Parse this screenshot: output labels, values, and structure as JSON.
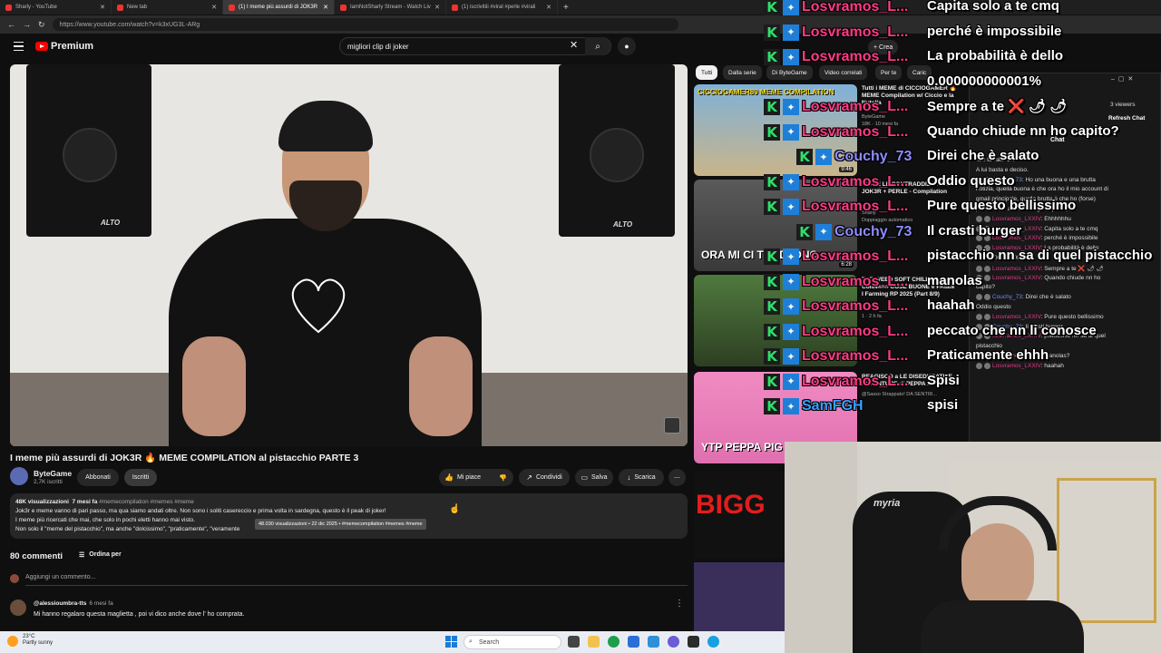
{
  "browser": {
    "tabs": [
      {
        "title": "Sharly - YouTube",
        "active": false
      },
      {
        "title": "New tab",
        "active": false
      },
      {
        "title": "(1) I meme più assurdi di JOK3R",
        "active": true
      },
      {
        "title": "IamNotSharly Stream - Watch Liv",
        "active": false
      },
      {
        "title": "(1) iscrivitiii #viral #perle #virali",
        "active": false
      }
    ],
    "url": "https://www.youtube.com/watch?v=k3xUG3L-ARg"
  },
  "youtube": {
    "logo": "Premium",
    "search_value": "migliori clip di joker",
    "create_label": "Crea",
    "video": {
      "title": "I meme più assurdi di JOK3R 🔥 MEME COMPILATION al pistacchio PARTE 3",
      "channel": "ByteGame",
      "subscribers": "2,7K iscritti",
      "subscriptions_label": "Abbonati",
      "subscribed_label": "Iscritti",
      "like_label": "Mi piace",
      "share_label": "Condividi",
      "save_label": "Salva",
      "download_label": "Scarica",
      "speaker_brand": "ALTO"
    },
    "description": {
      "views": "48K visualizzazioni",
      "date": "7 mesi fa",
      "tags": "#memecompilation #memes #meme",
      "line1": "Jok3r e meme vanno di pari passo, ma qua siamo andati oltre. Non sono i soliti casereccio e prima volta in sardegna, questo è il peak di joker!",
      "line2": "I meme più ricercati che mai, che solo in pochi eletti hanno mai visto.",
      "line3": "Non solo il \"meme del pistacchio\", ma anche \"dolcissimo\", \"praticamente\", \"veramente",
      "tooltip": "48.030 visualizzazioni • 22 dic 2025 • #memecompilation #memes #meme"
    },
    "comments": {
      "count": "80 commenti",
      "sort_label": "Ordina per",
      "add_placeholder": "Aggiungi un commento...",
      "items": [
        {
          "user": "@alessioumbra-tts",
          "time": "6 mesi fa",
          "text": "Mi hanno regalaro questa maglietta , poi vi dico anche dove l' ho comprata."
        }
      ]
    },
    "chips": [
      "Tutti",
      "Dalla serie",
      "Di ByteGame",
      "Video correlati",
      "Per te",
      "Caric"
    ],
    "recommendations": [
      {
        "title": "Tutti i MEME di CICCIOGAMER 🔥 MEME Compilation w/ Ciccio e la Nutella",
        "channel": "ByteGame",
        "meta": "18K · 10 mesi fa",
        "duration": "9:46",
        "thumb_text": "CICCIOGAMER89 MEME COMPILATION"
      },
      {
        "title": "TUTTE LE CONTRADDIZIONI di JOK3R + PERLE - Compilation",
        "channel": "Sharly",
        "meta": "Doppiaggio automatico",
        "duration": "6:28",
        "thumb_text": "ORA MI CI TRADI ONO"
      },
      {
        "title": "THE WEED SOFT CHILL Coltivano COSE BUONE e PAtate I Farming RP 2025 (Part 8/9)",
        "channel": "",
        "meta": "1 · 2 h fa",
        "duration": "",
        "thumb_text": ""
      },
      {
        "title": "REAGISCO a LE DISEDUCATIVE AVVENTURE di PEPPA PIG!",
        "channel": "@Sasso Strappato! DA SENTIR...",
        "meta": "",
        "duration": "",
        "thumb_text": "YTP PEPPA PIG REACTION"
      }
    ]
  },
  "chat_window": {
    "viewers": "3 viewers",
    "refresh_label": "Refresh Chat",
    "title": "Chat",
    "lines": [
      {
        "user": "",
        "text": "sub to take 1st"
      },
      {
        "user": "",
        "text": "A lui basta e deciso."
      },
      {
        "user": "Couchy_73",
        "text": "Ho una buona e una brutta"
      },
      {
        "user": "",
        "text": "notizia, quella buona è che ora ho il mio account di"
      },
      {
        "user": "",
        "text": "gmail principale, quella brutta è che ho (forse)"
      },
      {
        "user": "",
        "text": "perso il mio account di gmail principale"
      },
      {
        "user": "Losvramos_LXXIV",
        "text": "Ehhhhhhu"
      },
      {
        "user": "Losvramos_LXXIV",
        "text": "Capita solo a te cmq"
      },
      {
        "user": "Losvramos_LXXIV",
        "text": "perché è impossibile"
      },
      {
        "user": "Losvramos_LXXIV",
        "text": "La probabilità è dello"
      },
      {
        "user": "",
        "text": "0.0000000000001%"
      },
      {
        "user": "Losvramos_LXXIV",
        "text": "Sempre a te ❌ 🌶 🌶"
      },
      {
        "user": "Losvramos_LXXIV",
        "text": "Quando chiude nn ho"
      },
      {
        "user": "",
        "text": "capito?"
      },
      {
        "user": "Couchy_73",
        "text": "Direi che è salato"
      },
      {
        "user": "",
        "text": "Oddio questo"
      },
      {
        "user": "Losvramos_LXXIV",
        "text": "Pure questo bellissimo"
      },
      {
        "user": "Couchy_73",
        "text": "Il crasti burger"
      },
      {
        "user": "Losvramos_LXXIV",
        "text": "pistacchio nn sa di quel"
      },
      {
        "user": "",
        "text": "pistacchio"
      },
      {
        "user": "Losvramos_LXXIV",
        "text": "manolas?"
      },
      {
        "user": "Losvramos_LXXIV",
        "text": "haahah"
      }
    ]
  },
  "overlay": {
    "rows": [
      {
        "name": "Losvramos_L...",
        "msg": "Capita solo a te cmq",
        "kind": "l"
      },
      {
        "name": "Losvramos_L...",
        "msg": "perché è impossibile",
        "kind": "l"
      },
      {
        "name": "Losvramos_L...",
        "msg": "La probabilità è dello",
        "kind": "l"
      },
      {
        "name": "",
        "msg": "0.000000000001%",
        "kind": "none"
      },
      {
        "name": "Losvramos_L...",
        "msg": "Sempre a te ❌ 🌶 🌶",
        "kind": "l"
      },
      {
        "name": "Losvramos_L...",
        "msg": "Quando chiude nn ho capito?",
        "kind": "l"
      },
      {
        "name": "Couchy_73",
        "msg": "Direi che è salato",
        "kind": "c"
      },
      {
        "name": "Losvramos_L...",
        "msg": "Oddio questo",
        "kind": "l"
      },
      {
        "name": "Losvramos_L...",
        "msg": "Pure questo bellissimo",
        "kind": "l"
      },
      {
        "name": "Couchy_73",
        "msg": "Il crasti burger",
        "kind": "c"
      },
      {
        "name": "Losvramos_L...",
        "msg": "pistacchio nn sa di quel pistacchio",
        "kind": "l"
      },
      {
        "name": "Losvramos_L...",
        "msg": "manolas",
        "kind": "l"
      },
      {
        "name": "Losvramos_L...",
        "msg": "haahah",
        "kind": "l"
      },
      {
        "name": "Losvramos_L...",
        "msg": "peccato che nn li conosce",
        "kind": "l"
      },
      {
        "name": "Losvramos_L...",
        "msg": "Praticamente ehhh",
        "kind": "l"
      },
      {
        "name": "Losvramos_L...",
        "msg": "Spisi",
        "kind": "l"
      },
      {
        "name": "SamFGH",
        "msg": "spisi",
        "kind": "s"
      }
    ]
  },
  "webcam": {
    "chair_brand": "myria"
  },
  "taskbar": {
    "weather_temp": "23°C",
    "weather_desc": "Partly sunny",
    "search_label": "Search"
  }
}
